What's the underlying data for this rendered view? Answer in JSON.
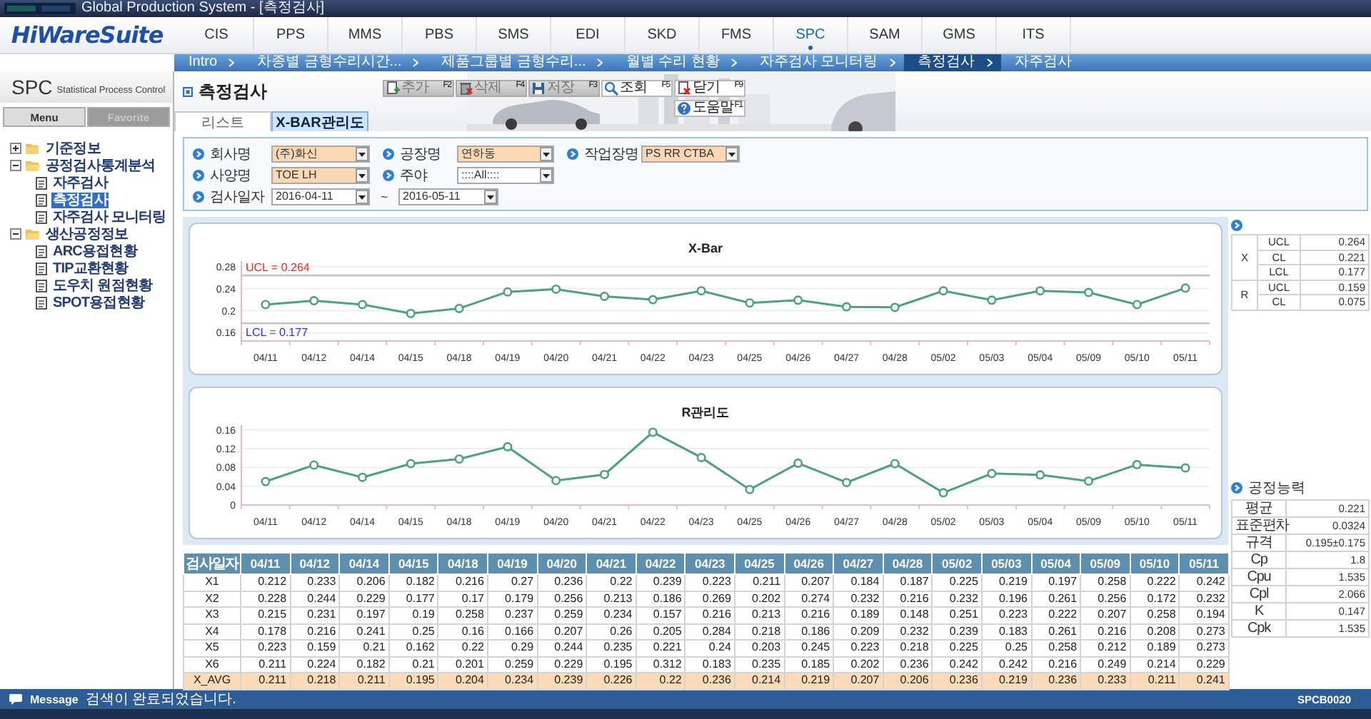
{
  "window": {
    "title": "Global Production System - [측정검사]"
  },
  "header": {
    "logo": "HiWareSuite",
    "modules": [
      {
        "label": "CIS",
        "selected": false
      },
      {
        "label": "PPS",
        "selected": false
      },
      {
        "label": "MMS",
        "selected": false
      },
      {
        "label": "PBS",
        "selected": false
      },
      {
        "label": "SMS",
        "selected": false
      },
      {
        "label": "EDI",
        "selected": false
      },
      {
        "label": "SKD",
        "selected": false
      },
      {
        "label": "FMS",
        "selected": false
      },
      {
        "label": "SPC",
        "selected": true
      },
      {
        "label": "SAM",
        "selected": false
      },
      {
        "label": "GMS",
        "selected": false
      },
      {
        "label": "ITS",
        "selected": false
      }
    ]
  },
  "nav_tabs": [
    {
      "label": "Intro",
      "selected": false
    },
    {
      "label": "차종별 금형수리시간...",
      "selected": false
    },
    {
      "label": "제품그룹별 금형수리...",
      "selected": false
    },
    {
      "label": "월별 수리 현황",
      "selected": false
    },
    {
      "label": "자주검사 모니터링",
      "selected": false
    },
    {
      "label": "측정검사",
      "selected": true
    },
    {
      "label": "자주검사",
      "selected": false
    }
  ],
  "sidebar": {
    "title": "SPC",
    "subtitle": "Statistical Process Control",
    "tabs": [
      {
        "label": "Menu",
        "selected": true
      },
      {
        "label": "Favorite",
        "selected": false
      }
    ],
    "tree": [
      {
        "label": "기준정보",
        "expanded": false
      },
      {
        "label": "공정검사통계분석",
        "expanded": true,
        "children": [
          {
            "label": "자주검사",
            "selected": false
          },
          {
            "label": "측정검사",
            "selected": true
          },
          {
            "label": "자주검사 모니터링",
            "selected": false
          }
        ]
      },
      {
        "label": "생산공정정보",
        "expanded": true,
        "children": [
          {
            "label": "ARC용접현황",
            "selected": false
          },
          {
            "label": "TIP교환현황",
            "selected": false
          },
          {
            "label": "도우치 원점현황",
            "selected": false
          },
          {
            "label": "SPOT용접현황",
            "selected": false
          }
        ]
      }
    ]
  },
  "page": {
    "title": "측정검사",
    "buttons": [
      {
        "label": "추가",
        "key": "F2",
        "disabled": true
      },
      {
        "label": "삭제",
        "key": "F4",
        "disabled": true
      },
      {
        "label": "저장",
        "key": "F3",
        "disabled": true
      },
      {
        "label": "조회",
        "key": "F5",
        "disabled": false
      },
      {
        "label": "닫기",
        "key": "F9",
        "disabled": false
      },
      {
        "label": "도움말",
        "key": "F1",
        "disabled": false
      }
    ],
    "tabs": [
      {
        "label": "리스트",
        "selected": false
      },
      {
        "label": "X-BAR관리도",
        "selected": true
      }
    ]
  },
  "filters": {
    "rows": [
      {
        "fields": [
          {
            "kind": "select",
            "label": "회사명",
            "value": "(주)화신",
            "required": true
          },
          {
            "kind": "select",
            "label": "공장명",
            "value": "연하동",
            "required": true
          },
          {
            "kind": "select",
            "label": "작업장명",
            "value": "PS RR CTBA",
            "required": true
          }
        ]
      },
      {
        "fields": [
          {
            "kind": "select",
            "label": "사양명",
            "value": "TOE LH",
            "required": true
          },
          {
            "kind": "select",
            "label": "주야",
            "value": "::::All::::",
            "required": false
          }
        ]
      },
      {
        "fields": [
          {
            "kind": "daterange",
            "label": "검사일자",
            "from": "2016-04-11",
            "separator": "~",
            "to": "2016-05-11"
          }
        ]
      }
    ]
  },
  "charts": [
    {
      "chart_data": {
        "type": "line",
        "title": "X-Bar",
        "categories": [
          "04/11",
          "04/12",
          "04/14",
          "04/15",
          "04/18",
          "04/19",
          "04/20",
          "04/21",
          "04/22",
          "04/23",
          "04/25",
          "04/26",
          "04/27",
          "04/28",
          "05/02",
          "05/03",
          "05/04",
          "05/09",
          "05/10",
          "05/11"
        ],
        "series": [
          {
            "color": "#4aa37a",
            "values": [
              0.211,
              0.218,
              0.211,
              0.195,
              0.204,
              0.234,
              0.239,
              0.226,
              0.22,
              0.236,
              0.214,
              0.219,
              0.207,
              0.206,
              0.236,
              0.219,
              0.236,
              0.233,
              0.211,
              0.241
            ]
          }
        ],
        "ylim": [
          0.145,
          0.29
        ],
        "yticks": [
          0.16,
          0.2,
          0.24,
          0.28
        ],
        "grid": true,
        "marker": "o",
        "ref_lines": [
          {
            "axis": "y",
            "value": 0.264,
            "label": "UCL = 0.264"
          },
          {
            "axis": "y",
            "value": 0.177,
            "label": "LCL = 0.177"
          }
        ]
      }
    },
    {
      "chart_data": {
        "type": "line",
        "title": "R관리도",
        "categories": [
          "04/11",
          "04/12",
          "04/14",
          "04/15",
          "04/18",
          "04/19",
          "04/20",
          "04/21",
          "04/22",
          "04/23",
          "04/25",
          "04/26",
          "04/27",
          "04/28",
          "05/02",
          "05/03",
          "05/04",
          "05/09",
          "05/10",
          "05/11"
        ],
        "series": [
          {
            "color": "#4aa37a",
            "values": [
              0.05,
              0.085,
              0.059,
              0.088,
              0.098,
              0.124,
              0.052,
              0.065,
              0.155,
              0.101,
              0.033,
              0.089,
              0.048,
              0.088,
              0.026,
              0.067,
              0.064,
              0.051,
              0.086,
              0.079
            ]
          }
        ],
        "ylim": [
          0,
          0.17
        ],
        "yticks": [
          0,
          0.04,
          0.08,
          0.12,
          0.16
        ],
        "grid": true,
        "marker": "o"
      }
    }
  ],
  "control_limits": {
    "groups": [
      {
        "name": "X",
        "rows": [
          {
            "limit": "UCL",
            "value": "0.264"
          },
          {
            "limit": "CL",
            "value": "0.221"
          },
          {
            "limit": "LCL",
            "value": "0.177"
          }
        ]
      },
      {
        "name": "R",
        "rows": [
          {
            "limit": "UCL",
            "value": "0.159"
          },
          {
            "limit": "CL",
            "value": "0.075"
          }
        ]
      }
    ]
  },
  "process_capability": {
    "title": "공정능력",
    "rows": [
      {
        "label": "평균",
        "value": "0.221"
      },
      {
        "label": "표준편차",
        "value": "0.0324"
      },
      {
        "label": "규격",
        "value": "0.195±0.175"
      },
      {
        "label": "Cp",
        "value": "1.8"
      },
      {
        "label": "Cpu",
        "value": "1.535"
      },
      {
        "label": "Cpl",
        "value": "2.066"
      },
      {
        "label": "K",
        "value": "0.147"
      },
      {
        "label": "Cpk",
        "value": "1.535"
      }
    ]
  },
  "table": {
    "columns": [
      "검사일자",
      "04/11",
      "04/12",
      "04/14",
      "04/15",
      "04/18",
      "04/19",
      "04/20",
      "04/21",
      "04/22",
      "04/23",
      "04/25",
      "04/26",
      "04/27",
      "04/28",
      "05/02",
      "05/03",
      "05/04",
      "05/09",
      "05/10",
      "05/11"
    ],
    "rows": [
      {
        "kind": "sample",
        "label": "X1",
        "values": [
          "0.212",
          "0.233",
          "0.206",
          "0.182",
          "0.216",
          "0.27",
          "0.236",
          "0.22",
          "0.239",
          "0.223",
          "0.211",
          "0.207",
          "0.184",
          "0.187",
          "0.225",
          "0.219",
          "0.197",
          "0.258",
          "0.222",
          "0.242"
        ]
      },
      {
        "kind": "sample",
        "label": "X2",
        "values": [
          "0.228",
          "0.244",
          "0.229",
          "0.177",
          "0.17",
          "0.179",
          "0.256",
          "0.213",
          "0.186",
          "0.269",
          "0.202",
          "0.274",
          "0.232",
          "0.216",
          "0.232",
          "0.196",
          "0.261",
          "0.256",
          "0.172",
          "0.232"
        ]
      },
      {
        "kind": "sample",
        "label": "X3",
        "values": [
          "0.215",
          "0.231",
          "0.197",
          "0.19",
          "0.258",
          "0.237",
          "0.259",
          "0.234",
          "0.157",
          "0.216",
          "0.213",
          "0.216",
          "0.189",
          "0.148",
          "0.251",
          "0.223",
          "0.222",
          "0.207",
          "0.258",
          "0.194"
        ]
      },
      {
        "kind": "sample",
        "label": "X4",
        "values": [
          "0.178",
          "0.216",
          "0.241",
          "0.25",
          "0.16",
          "0.166",
          "0.207",
          "0.26",
          "0.205",
          "0.284",
          "0.218",
          "0.186",
          "0.209",
          "0.232",
          "0.239",
          "0.183",
          "0.261",
          "0.216",
          "0.208",
          "0.273"
        ]
      },
      {
        "kind": "sample",
        "label": "X5",
        "values": [
          "0.223",
          "0.159",
          "0.21",
          "0.162",
          "0.22",
          "0.29",
          "0.244",
          "0.235",
          "0.221",
          "0.24",
          "0.203",
          "0.245",
          "0.223",
          "0.218",
          "0.225",
          "0.25",
          "0.258",
          "0.212",
          "0.189",
          "0.273"
        ]
      },
      {
        "kind": "sample",
        "label": "X6",
        "values": [
          "0.211",
          "0.224",
          "0.182",
          "0.21",
          "0.201",
          "0.259",
          "0.229",
          "0.195",
          "0.312",
          "0.183",
          "0.235",
          "0.185",
          "0.202",
          "0.236",
          "0.242",
          "0.242",
          "0.216",
          "0.249",
          "0.214",
          "0.229"
        ]
      },
      {
        "kind": "average",
        "label": "X_AVG",
        "values": [
          "0.211",
          "0.218",
          "0.211",
          "0.195",
          "0.204",
          "0.234",
          "0.239",
          "0.226",
          "0.22",
          "0.236",
          "0.214",
          "0.219",
          "0.207",
          "0.206",
          "0.236",
          "0.219",
          "0.236",
          "0.233",
          "0.211",
          "0.241"
        ]
      }
    ]
  },
  "status_bar": {
    "label": "Message",
    "message": "검색이 완료되었습니다.",
    "code": "SPCB0020"
  }
}
